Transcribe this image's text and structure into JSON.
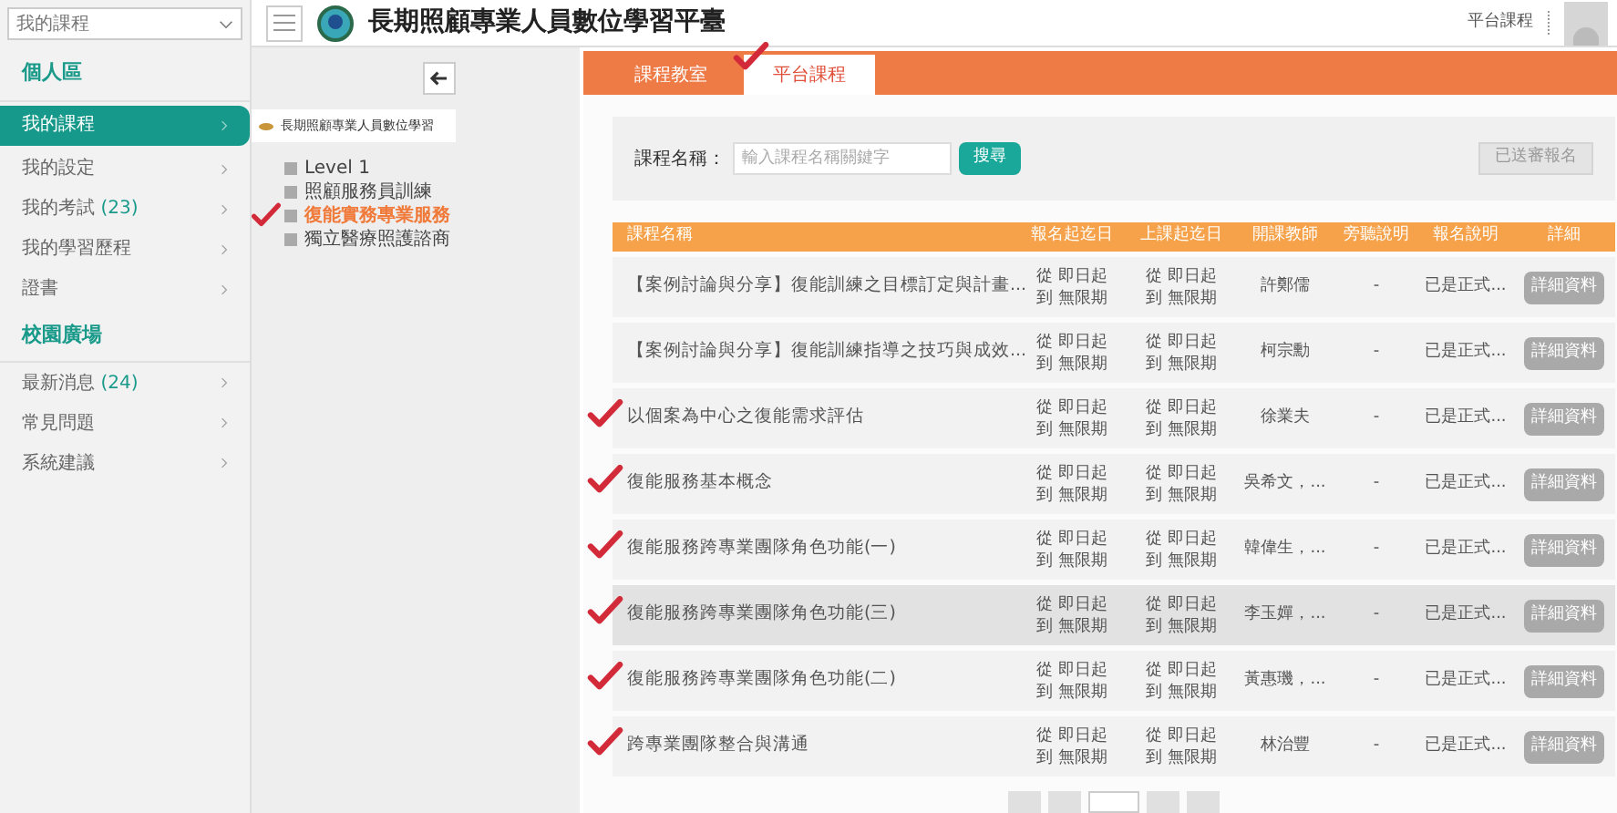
{
  "sidebar": {
    "dropdown": "我的課程",
    "sections": [
      {
        "title": "個人區",
        "items": [
          {
            "label": "我的課程",
            "selected": true
          },
          {
            "label": "我的設定",
            "selected": false
          },
          {
            "label": "我的考試",
            "count": "(23)",
            "selected": false
          },
          {
            "label": "我的學習歷程",
            "selected": false
          },
          {
            "label": "證書",
            "selected": false
          }
        ]
      },
      {
        "title": "校園廣場",
        "items": [
          {
            "label": "最新消息",
            "count": "(24)",
            "selected": false
          },
          {
            "label": "常見問題",
            "selected": false
          },
          {
            "label": "系統建議",
            "selected": false
          }
        ]
      }
    ]
  },
  "header": {
    "title": "長期照顧專業人員數位學習平臺",
    "link": "平台課程"
  },
  "tree": {
    "title": "長期照顧專業人員數位學習",
    "children": [
      {
        "label": "Level 1",
        "selected": false,
        "marked": false
      },
      {
        "label": "照顧服務員訓練",
        "selected": false,
        "marked": false
      },
      {
        "label": "復能實務專業服務",
        "selected": true,
        "marked": true
      },
      {
        "label": "獨立醫療照護諮商",
        "selected": false,
        "marked": false
      }
    ]
  },
  "tabs": [
    {
      "label": "課程教室",
      "selected": false,
      "marked": false
    },
    {
      "label": "平台課程",
      "selected": true,
      "marked": true
    }
  ],
  "search": {
    "label": "課程名稱：",
    "placeholder": "輸入課程名稱關鍵字",
    "button": "搜尋",
    "side_button": "已送審報名"
  },
  "table": {
    "columns": [
      "課程名稱",
      "報名起迄日",
      "上課起迄日",
      "開課教師",
      "旁聽說明",
      "報名說明",
      "詳細"
    ],
    "rows": [
      {
        "name": "【案例討論與分享】復能訓練之目標訂定與計畫...",
        "signup": [
          "從 即日起",
          "到 無限期"
        ],
        "class": [
          "從 即日起",
          "到 無限期"
        ],
        "teacher": "許鄭儒",
        "audit": "-",
        "status": "已是正式...",
        "button": "詳細資料",
        "marked": false,
        "highlighted": false
      },
      {
        "name": "【案例討論與分享】復能訓練指導之技巧與成效...",
        "signup": [
          "從 即日起",
          "到 無限期"
        ],
        "class": [
          "從 即日起",
          "到 無限期"
        ],
        "teacher": "柯宗勳",
        "audit": "-",
        "status": "已是正式...",
        "button": "詳細資料",
        "marked": false,
        "highlighted": false
      },
      {
        "name": "以個案為中心之復能需求評估",
        "signup": [
          "從 即日起",
          "到 無限期"
        ],
        "class": [
          "從 即日起",
          "到 無限期"
        ],
        "teacher": "徐業夫",
        "audit": "-",
        "status": "已是正式...",
        "button": "詳細資料",
        "marked": true,
        "highlighted": false
      },
      {
        "name": "復能服務基本概念",
        "signup": [
          "從 即日起",
          "到 無限期"
        ],
        "class": [
          "從 即日起",
          "到 無限期"
        ],
        "teacher": "吳希文，...",
        "audit": "-",
        "status": "已是正式...",
        "button": "詳細資料",
        "marked": true,
        "highlighted": false
      },
      {
        "name": "復能服務跨專業團隊角色功能(一)",
        "signup": [
          "從 即日起",
          "到 無限期"
        ],
        "class": [
          "從 即日起",
          "到 無限期"
        ],
        "teacher": "韓偉生，...",
        "audit": "-",
        "status": "已是正式...",
        "button": "詳細資料",
        "marked": true,
        "highlighted": false
      },
      {
        "name": "復能服務跨專業團隊角色功能(三)",
        "signup": [
          "從 即日起",
          "到 無限期"
        ],
        "class": [
          "從 即日起",
          "到 無限期"
        ],
        "teacher": "李玉嬋，...",
        "audit": "-",
        "status": "已是正式...",
        "button": "詳細資料",
        "marked": true,
        "highlighted": true
      },
      {
        "name": "復能服務跨專業團隊角色功能(二)",
        "signup": [
          "從 即日起",
          "到 無限期"
        ],
        "class": [
          "從 即日起",
          "到 無限期"
        ],
        "teacher": "黃惠璣，...",
        "audit": "-",
        "status": "已是正式...",
        "button": "詳細資料",
        "marked": true,
        "highlighted": false
      },
      {
        "name": "跨專業團隊整合與溝通",
        "signup": [
          "從 即日起",
          "到 無限期"
        ],
        "class": [
          "從 即日起",
          "到 無限期"
        ],
        "teacher": "林治豐",
        "audit": "-",
        "status": "已是正式...",
        "button": "詳細資料",
        "marked": true,
        "highlighted": false
      }
    ]
  }
}
